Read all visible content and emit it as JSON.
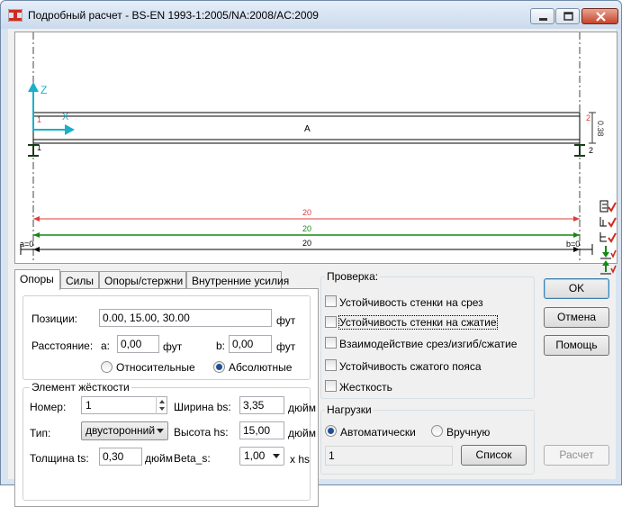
{
  "window": {
    "title": "Подробный расчет - BS-EN 1993-1:2005/NA:2008/AC:2009",
    "controls": {
      "minimize": "minimize",
      "maximize": "maximize",
      "close": "close"
    }
  },
  "canvas": {
    "axis_z": "Z",
    "axis_x": "X",
    "beam_label": "A",
    "height_label": "0.38",
    "left_end_red": "1",
    "left_end_black": "1",
    "right_end_red": "2",
    "right_end_black": "2",
    "dims": [
      "20",
      "20",
      "20"
    ],
    "dim_colors": [
      "#e03b3b",
      "#138a13",
      "#000000"
    ],
    "left_a": "a=0",
    "right_b": "b=0"
  },
  "tabs": [
    {
      "label": "Опоры",
      "active": true
    },
    {
      "label": "Силы",
      "active": false
    },
    {
      "label": "Опоры/стержни",
      "active": false
    },
    {
      "label": "Внутренние усилия",
      "active": false
    }
  ],
  "supports": {
    "positions_label": "Позиции:",
    "positions_value": "0.00, 15.00, 30.00",
    "positions_unit": "фут",
    "distance_label": "Расстояние:",
    "a_label": "a:",
    "a_value": "0,00",
    "a_unit": "фут",
    "b_label": "b:",
    "b_value": "0,00",
    "b_unit": "фут",
    "relative_label": "Относительные",
    "absolute_label": "Абсолютные",
    "absolute_selected": true
  },
  "stiffener": {
    "group_title": "Элемент жёсткости",
    "number_label": "Номер:",
    "number_value": "1",
    "type_label": "Тип:",
    "type_value": "двусторонний",
    "thickness_label": "Толщина ts:",
    "thickness_value": "0,30",
    "thickness_unit": "дюйм",
    "width_label": "Ширина bs:",
    "width_value": "3,35",
    "width_unit": "дюйм",
    "height_label": "Высота hs:",
    "height_value": "15,00",
    "height_unit": "дюйм",
    "beta_label": "Beta_s:",
    "beta_value": "1,00",
    "beta_unit": "x  hs"
  },
  "check": {
    "title": "Проверка:",
    "items": [
      {
        "label": "Устойчивость стенки на срез",
        "checked": false
      },
      {
        "label": "Устойчивость стенки на сжатие",
        "checked": false
      },
      {
        "label": "Взаимодействие  срез/изгиб/сжатие",
        "checked": false
      },
      {
        "label": "Устойчивость сжатого пояса",
        "checked": false
      },
      {
        "label": "Жесткость",
        "checked": false
      }
    ]
  },
  "loads": {
    "title": "Нагрузки",
    "auto_label": "Автоматически",
    "manual_label": "Вручную",
    "auto_selected": true,
    "value": "1",
    "list_button": "Список"
  },
  "buttons": {
    "ok": "OK",
    "cancel": "Отмена",
    "help": "Помощь",
    "calc": "Расчет"
  },
  "colors": {
    "accent_cyan": "#1ab0c8",
    "red": "#e03b3b",
    "green": "#138a13"
  }
}
